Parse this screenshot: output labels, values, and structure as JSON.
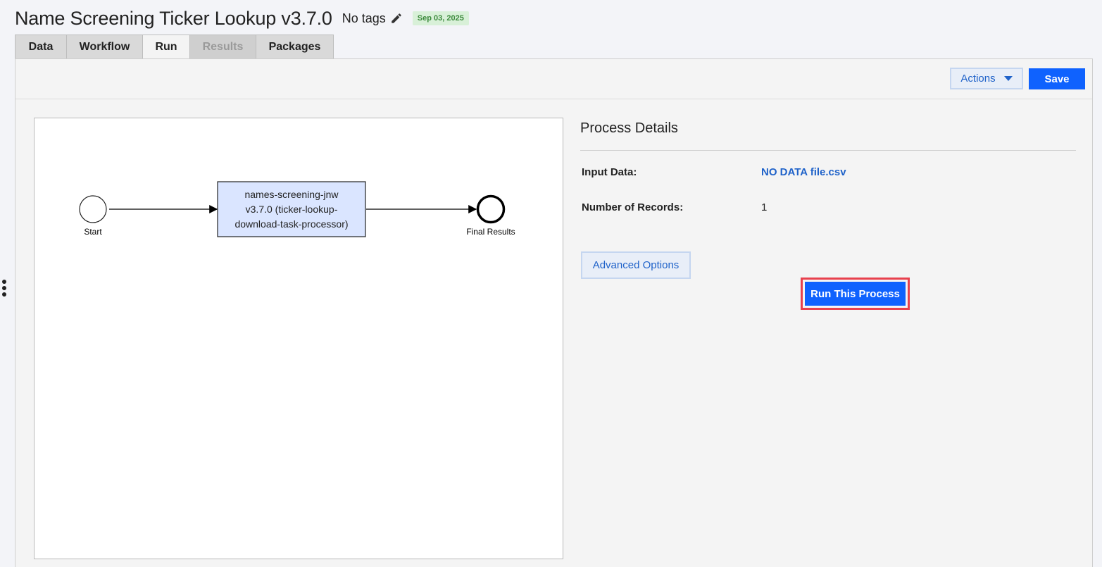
{
  "header": {
    "title": "Name Screening Ticker Lookup v3.7.0",
    "tags_label": "No tags",
    "date": "Sep 03, 2025"
  },
  "tabs": [
    {
      "label": "Data",
      "state": "normal"
    },
    {
      "label": "Workflow",
      "state": "normal"
    },
    {
      "label": "Run",
      "state": "active"
    },
    {
      "label": "Results",
      "state": "disabled"
    },
    {
      "label": "Packages",
      "state": "normal"
    }
  ],
  "toolbar": {
    "actions_label": "Actions",
    "save_label": "Save"
  },
  "diagram": {
    "start_label": "Start",
    "task_lines": [
      "names-screening-jnw",
      "v3.7.0 (ticker-lookup-",
      "download-task-processor)"
    ],
    "end_label": "Final Results"
  },
  "details": {
    "title": "Process Details",
    "input_data_label": "Input Data:",
    "input_data_value": "NO DATA file.csv",
    "records_label": "Number of Records:",
    "records_value": "1",
    "advanced_label": "Advanced Options",
    "run_label": "Run This Process"
  },
  "colors": {
    "primary": "#0f62fe",
    "link": "#1f62c9",
    "highlight": "#e8414d",
    "task_fill": "#dae5ff",
    "date_badge_bg": "#d8f0d8",
    "date_badge_text": "#3c8a3c"
  }
}
